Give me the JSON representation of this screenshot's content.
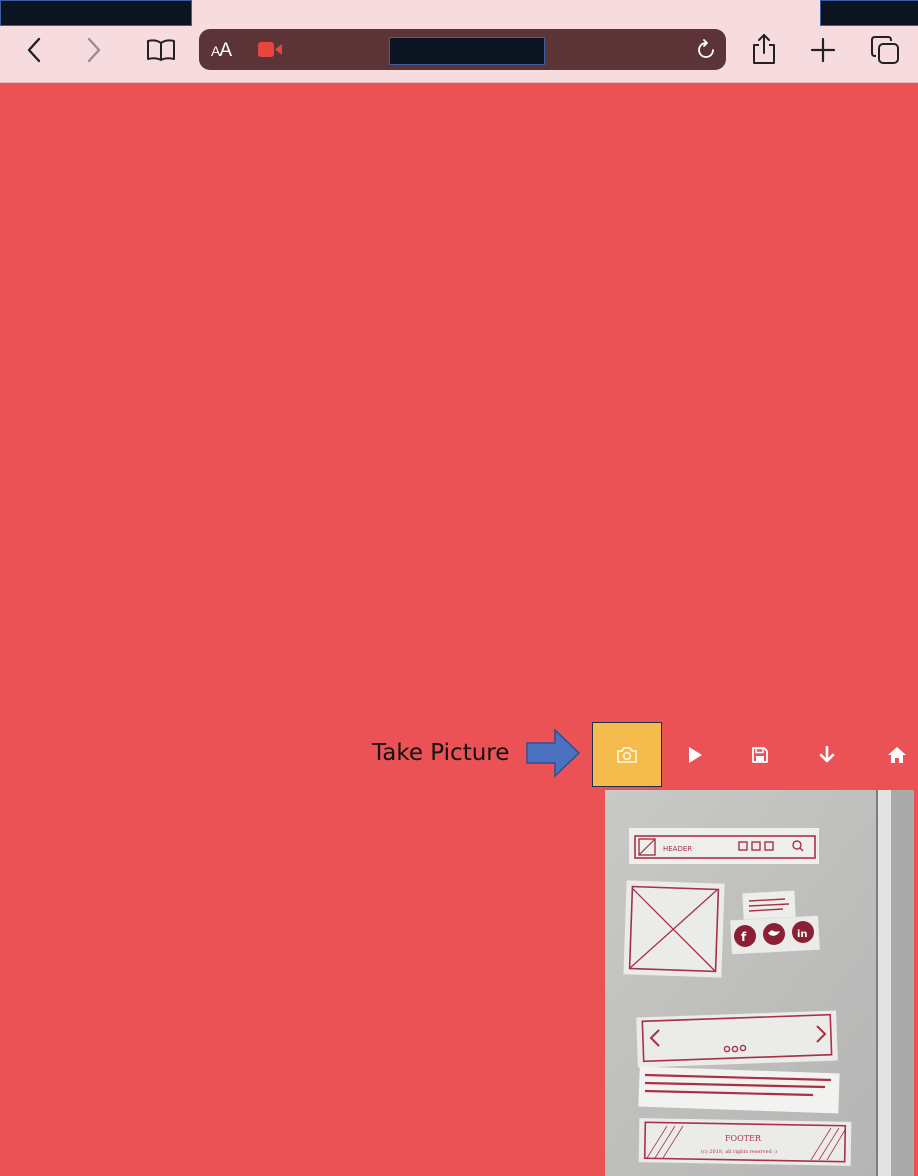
{
  "browser": {
    "address_text": "",
    "text_size_label": "AA",
    "icons": {
      "back": "chevron-left-icon",
      "forward": "chevron-right-icon",
      "bookmarks": "book-icon",
      "recording": "video-camera-icon",
      "reload": "reload-icon",
      "share": "share-icon",
      "new_tab": "plus-icon",
      "tabs": "tabs-icon"
    }
  },
  "app": {
    "annotation_label": "Take Picture",
    "toolbar_icons": [
      "camera-icon",
      "play-icon",
      "save-icon",
      "download-arrow-icon",
      "home-icon"
    ]
  },
  "photo": {
    "header_text": "HEADER",
    "footer_text": "FOOTER",
    "footer_small_text": "(c) 2018, all rights reserved :)"
  },
  "colors": {
    "page_background": "#eb5255",
    "toolbar_background": "#f7dcdf",
    "address_bar": "#5c3437",
    "camera_button": "#f5bc4d",
    "arrow": "#4a72c0",
    "sketch_ink": "#a83146"
  }
}
